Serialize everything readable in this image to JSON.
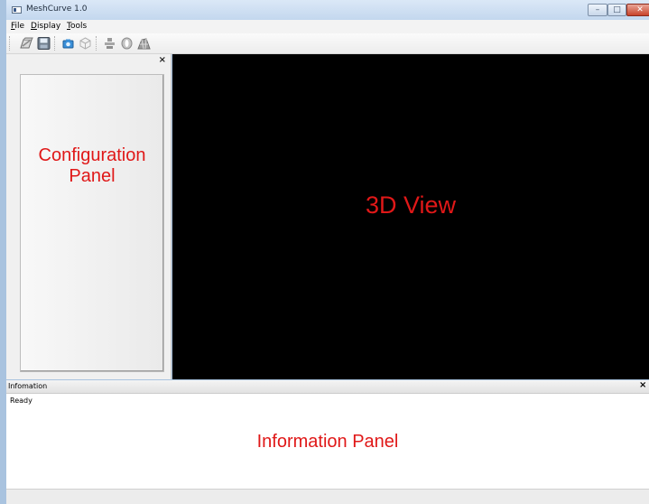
{
  "window": {
    "title": "MeshCurve 1.0",
    "min_glyph": "–",
    "max_glyph": "□",
    "close_glyph": "✕"
  },
  "menubar": {
    "items": [
      {
        "accel": "F",
        "rest": "ile"
      },
      {
        "accel": "D",
        "rest": "isplay"
      },
      {
        "accel": "T",
        "rest": "ools"
      }
    ]
  },
  "toolbar": {
    "buttons": [
      {
        "icon": "open-folder-icon",
        "enabled": true
      },
      {
        "icon": "save-disk-icon",
        "enabled": true
      },
      {
        "icon": "camera-icon",
        "enabled": true
      },
      {
        "icon": "cube-icon",
        "enabled": false
      },
      {
        "icon": "stack-icon",
        "enabled": false
      },
      {
        "icon": "slice-icon",
        "enabled": false
      },
      {
        "icon": "mesh-icon",
        "enabled": false
      }
    ]
  },
  "config_panel": {
    "close_glyph": "×",
    "label_line1": "Configuration",
    "label_line2": "Panel"
  },
  "view3d": {
    "label": "3D View"
  },
  "info_panel": {
    "title": "Infomation",
    "close_glyph": "×",
    "status": "Ready",
    "label": "Information Panel"
  },
  "colors": {
    "annotation": "#e01818",
    "view_background": "#000000",
    "accent_blue": "#3a8fd8"
  }
}
